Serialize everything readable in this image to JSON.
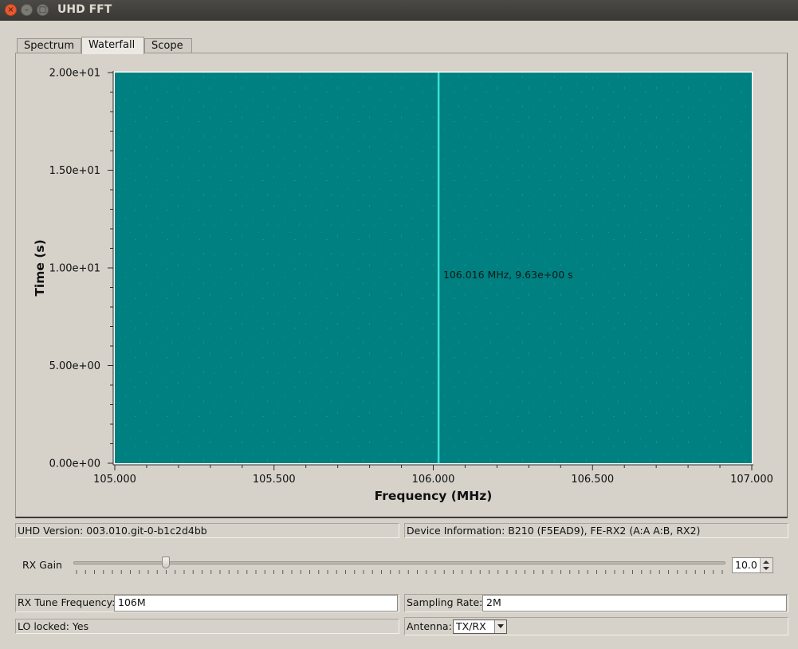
{
  "window": {
    "title": "UHD FFT",
    "close_glyph": "×",
    "min_glyph": "–",
    "max_glyph": "□"
  },
  "tabs": [
    {
      "label": "Spectrum",
      "active": false
    },
    {
      "label": "Waterfall",
      "active": true
    },
    {
      "label": "Scope",
      "active": false
    }
  ],
  "plot": {
    "background_color": "#008080",
    "signal_color": "#3be0d6",
    "marker_text": "106.016 MHz, 9.63e+00 s"
  },
  "chart_data": {
    "type": "heatmap",
    "title": "",
    "xlabel": "Frequency (MHz)",
    "ylabel": "Time (s)",
    "xlim": [
      105.0,
      107.0
    ],
    "ylim": [
      0,
      20
    ],
    "x_ticks": [
      "105.000",
      "105.500",
      "106.000",
      "106.500",
      "107.000"
    ],
    "y_ticks": [
      "0.00e+00",
      "5.00e+00",
      "1.00e+01",
      "1.50e+01",
      "2.00e+01"
    ],
    "x_tick_values": [
      105.0,
      105.5,
      106.0,
      106.5,
      107.0
    ],
    "y_tick_values": [
      0,
      5,
      10,
      15,
      20
    ],
    "signal_frequency": 106.016,
    "marker": {
      "x": 106.016,
      "y": 9.63
    }
  },
  "status": {
    "uhd_version": "UHD Version: 003.010.git-0-b1c2d4bb",
    "device_info": "Device Information: B210 (F5EAD9), FE-RX2 (A:A A:B, RX2)"
  },
  "controls": {
    "rx_gain_label": "RX Gain",
    "rx_gain_value": "10.0",
    "rx_gain_fraction": 0.137,
    "rx_tune_label": "RX Tune Frequency:",
    "rx_tune_value": "106M",
    "sampling_rate_label": "Sampling Rate:",
    "sampling_rate_value": "2M",
    "lo_locked": "LO locked: Yes",
    "antenna_label": "Antenna:",
    "antenna_value": "TX/RX"
  }
}
